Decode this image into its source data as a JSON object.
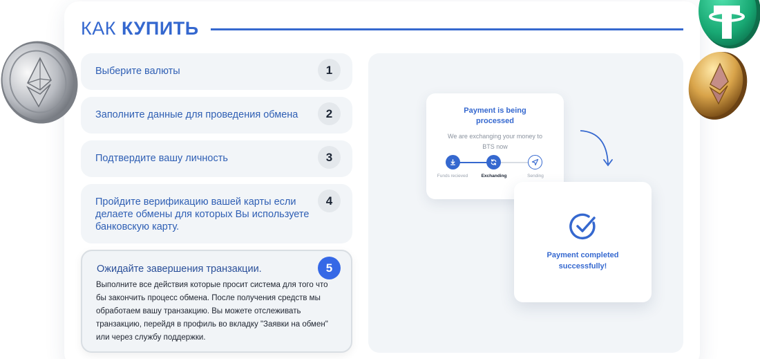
{
  "header": {
    "title_light": "КАК",
    "title_bold": "КУПИТЬ"
  },
  "steps": [
    {
      "number": "1",
      "label": "Выберите валюты"
    },
    {
      "number": "2",
      "label": "Заполните данные для проведения обмена"
    },
    {
      "number": "3",
      "label": "Подтвердите вашу личность"
    },
    {
      "number": "4",
      "label": "Пройдите верификацию вашей карты если делаете обмены для которых Вы используете банковскую карту."
    },
    {
      "number": "5",
      "label": "Ожидайте завершения транзакции.",
      "description": "Выполните все действия которые просит система для того что бы закончить процесс обмена. После получения средств мы обработаем вашу транзакцию. Вы можете отслеживать транзакцию, перейдя в профиль во вкладку \"Заявки на обмен\" или через службу поддержки."
    }
  ],
  "processing_card": {
    "title": "Payment is being processed",
    "subtitle": "We are exchanging your money to BTS now",
    "stages": [
      "Funds recieved",
      "Exchanding",
      "Sending"
    ],
    "active_stage": "Exchanding"
  },
  "completed_card": {
    "text": "Payment completed successfully!"
  },
  "colors": {
    "accent": "#3568cf",
    "active_step": "#3568e6",
    "panel_bg": "#f2f5f8"
  },
  "icons": [
    "ethereum-silver-coin",
    "tether-green-coin",
    "ethereum-gold-coin",
    "download-icon",
    "refresh-icon",
    "send-icon",
    "checkmark-circle-icon",
    "curved-arrow"
  ]
}
